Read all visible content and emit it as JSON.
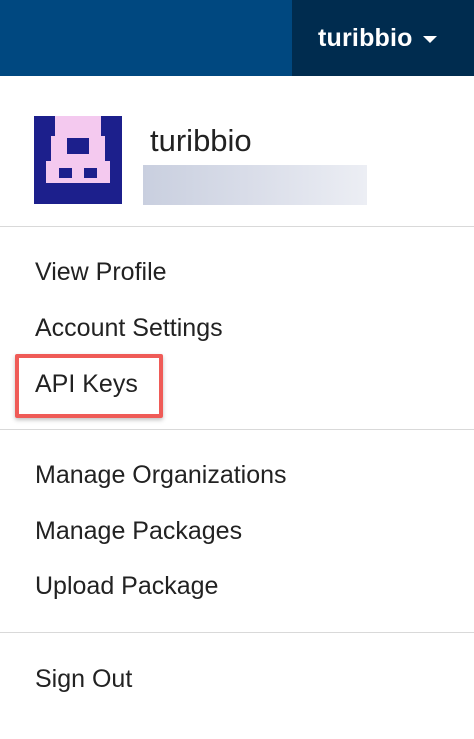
{
  "header": {
    "username": "turibbio"
  },
  "profile": {
    "display_name": "turibbio"
  },
  "menu": {
    "group1": [
      "View Profile",
      "Account Settings",
      "API Keys"
    ],
    "group2": [
      "Manage Organizations",
      "Manage Packages",
      "Upload Package"
    ],
    "group3": [
      "Sign Out"
    ]
  },
  "colors": {
    "header_bg": "#004880",
    "user_toggle_bg": "#002c4f",
    "avatar_bg": "#1c1f8c",
    "avatar_fg": "#f4c9ef",
    "highlight": "#ef5b57"
  }
}
